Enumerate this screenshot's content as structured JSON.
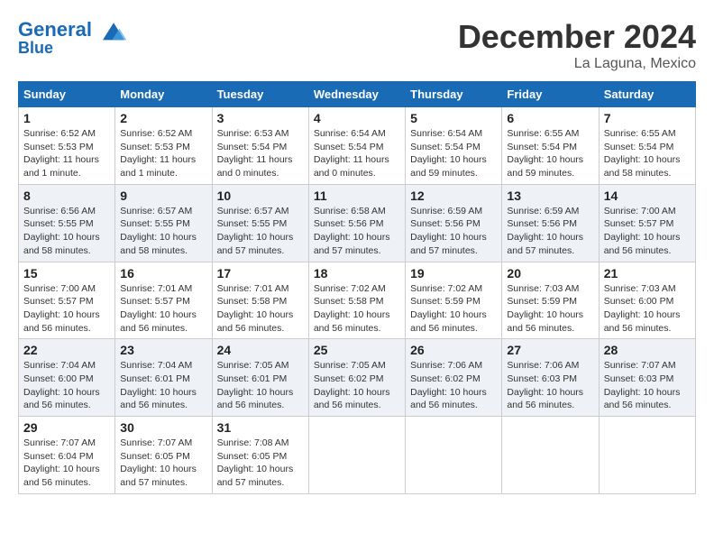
{
  "header": {
    "logo_line1": "General",
    "logo_line2": "Blue",
    "month_title": "December 2024",
    "location": "La Laguna, Mexico"
  },
  "weekdays": [
    "Sunday",
    "Monday",
    "Tuesday",
    "Wednesday",
    "Thursday",
    "Friday",
    "Saturday"
  ],
  "weeks": [
    [
      {
        "day": "1",
        "info": "Sunrise: 6:52 AM\nSunset: 5:53 PM\nDaylight: 11 hours and 1 minute."
      },
      {
        "day": "2",
        "info": "Sunrise: 6:52 AM\nSunset: 5:53 PM\nDaylight: 11 hours and 1 minute."
      },
      {
        "day": "3",
        "info": "Sunrise: 6:53 AM\nSunset: 5:54 PM\nDaylight: 11 hours and 0 minutes."
      },
      {
        "day": "4",
        "info": "Sunrise: 6:54 AM\nSunset: 5:54 PM\nDaylight: 11 hours and 0 minutes."
      },
      {
        "day": "5",
        "info": "Sunrise: 6:54 AM\nSunset: 5:54 PM\nDaylight: 10 hours and 59 minutes."
      },
      {
        "day": "6",
        "info": "Sunrise: 6:55 AM\nSunset: 5:54 PM\nDaylight: 10 hours and 59 minutes."
      },
      {
        "day": "7",
        "info": "Sunrise: 6:55 AM\nSunset: 5:54 PM\nDaylight: 10 hours and 58 minutes."
      }
    ],
    [
      {
        "day": "8",
        "info": "Sunrise: 6:56 AM\nSunset: 5:55 PM\nDaylight: 10 hours and 58 minutes."
      },
      {
        "day": "9",
        "info": "Sunrise: 6:57 AM\nSunset: 5:55 PM\nDaylight: 10 hours and 58 minutes."
      },
      {
        "day": "10",
        "info": "Sunrise: 6:57 AM\nSunset: 5:55 PM\nDaylight: 10 hours and 57 minutes."
      },
      {
        "day": "11",
        "info": "Sunrise: 6:58 AM\nSunset: 5:56 PM\nDaylight: 10 hours and 57 minutes."
      },
      {
        "day": "12",
        "info": "Sunrise: 6:59 AM\nSunset: 5:56 PM\nDaylight: 10 hours and 57 minutes."
      },
      {
        "day": "13",
        "info": "Sunrise: 6:59 AM\nSunset: 5:56 PM\nDaylight: 10 hours and 57 minutes."
      },
      {
        "day": "14",
        "info": "Sunrise: 7:00 AM\nSunset: 5:57 PM\nDaylight: 10 hours and 56 minutes."
      }
    ],
    [
      {
        "day": "15",
        "info": "Sunrise: 7:00 AM\nSunset: 5:57 PM\nDaylight: 10 hours and 56 minutes."
      },
      {
        "day": "16",
        "info": "Sunrise: 7:01 AM\nSunset: 5:57 PM\nDaylight: 10 hours and 56 minutes."
      },
      {
        "day": "17",
        "info": "Sunrise: 7:01 AM\nSunset: 5:58 PM\nDaylight: 10 hours and 56 minutes."
      },
      {
        "day": "18",
        "info": "Sunrise: 7:02 AM\nSunset: 5:58 PM\nDaylight: 10 hours and 56 minutes."
      },
      {
        "day": "19",
        "info": "Sunrise: 7:02 AM\nSunset: 5:59 PM\nDaylight: 10 hours and 56 minutes."
      },
      {
        "day": "20",
        "info": "Sunrise: 7:03 AM\nSunset: 5:59 PM\nDaylight: 10 hours and 56 minutes."
      },
      {
        "day": "21",
        "info": "Sunrise: 7:03 AM\nSunset: 6:00 PM\nDaylight: 10 hours and 56 minutes."
      }
    ],
    [
      {
        "day": "22",
        "info": "Sunrise: 7:04 AM\nSunset: 6:00 PM\nDaylight: 10 hours and 56 minutes."
      },
      {
        "day": "23",
        "info": "Sunrise: 7:04 AM\nSunset: 6:01 PM\nDaylight: 10 hours and 56 minutes."
      },
      {
        "day": "24",
        "info": "Sunrise: 7:05 AM\nSunset: 6:01 PM\nDaylight: 10 hours and 56 minutes."
      },
      {
        "day": "25",
        "info": "Sunrise: 7:05 AM\nSunset: 6:02 PM\nDaylight: 10 hours and 56 minutes."
      },
      {
        "day": "26",
        "info": "Sunrise: 7:06 AM\nSunset: 6:02 PM\nDaylight: 10 hours and 56 minutes."
      },
      {
        "day": "27",
        "info": "Sunrise: 7:06 AM\nSunset: 6:03 PM\nDaylight: 10 hours and 56 minutes."
      },
      {
        "day": "28",
        "info": "Sunrise: 7:07 AM\nSunset: 6:03 PM\nDaylight: 10 hours and 56 minutes."
      }
    ],
    [
      {
        "day": "29",
        "info": "Sunrise: 7:07 AM\nSunset: 6:04 PM\nDaylight: 10 hours and 56 minutes."
      },
      {
        "day": "30",
        "info": "Sunrise: 7:07 AM\nSunset: 6:05 PM\nDaylight: 10 hours and 57 minutes."
      },
      {
        "day": "31",
        "info": "Sunrise: 7:08 AM\nSunset: 6:05 PM\nDaylight: 10 hours and 57 minutes."
      },
      null,
      null,
      null,
      null
    ]
  ]
}
